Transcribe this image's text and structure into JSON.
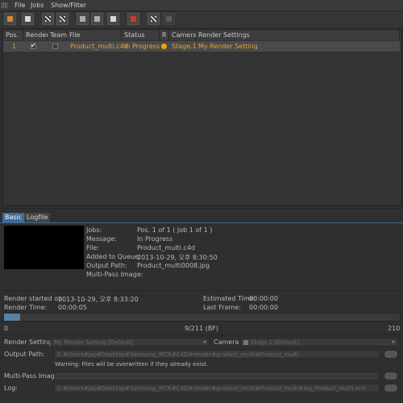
{
  "menu": [
    "File",
    "Jobs",
    "Show/Filter"
  ],
  "toolbar": {
    "icons": [
      "open-folder-icon",
      "new-document-icon",
      "clapboard-icon",
      "grid-clapboard-icon",
      "table-view-icon",
      "table-view-alt-icon",
      "document-list-icon",
      "render-stop-icon",
      "render-start-icon",
      "render-settings-disabled-icon"
    ]
  },
  "table": {
    "headers": [
      "Pos.",
      "Render",
      "Team",
      "File",
      "Status",
      "R",
      "Camera",
      "Render Settings"
    ],
    "rows": [
      {
        "pos": "1",
        "render": true,
        "team": false,
        "file": "Product_multi.c4d",
        "status": "In Progress",
        "camera": "Stage.1",
        "render_settings": "My Render Setting"
      }
    ]
  },
  "tabs": [
    "Basic",
    "Logfile"
  ],
  "details": {
    "jobs_label": "Jobs:",
    "jobs": "Pos. 1 of 1 ( Job 1 of 1 )",
    "message_label": "Message:",
    "message": "In Progress",
    "file_label": "File:",
    "file": "Product_multi.c4d",
    "added_label": "Added to Queue:",
    "added": "2013-10-29, 오후 8:30:50",
    "output_label": "Output Path:",
    "output": "Product_multi0008.jpg",
    "multipass_label": "Multi-Pass Image:"
  },
  "stats": {
    "started_label": "Render started on:",
    "started": "2013-10-29, 오후 8:33:20",
    "estimated_label": "Estimated Time:",
    "estimated": "00:00:00",
    "render_time_label": "Render Time:",
    "render_time": "00:00:05",
    "last_frame_label": "Last Frame:",
    "last_frame": "00:00:00"
  },
  "progress": {
    "start": "0",
    "status": "9/211 (BF)",
    "end": "210",
    "value": 0.04
  },
  "settings": {
    "render_settings_label": "Render Settings",
    "render_settings_value": "My Render Setting [Default]",
    "camera_label": "Camera",
    "camera_value": "Stage.1 [Default]",
    "output_path_label": "Output Path:",
    "output_path": "C:#Users#jap#Desktop#Samsung_IPCR#C4D#render#product_multi#Product_multi",
    "warning": "Warning: Files will be overwritten if they already exist.",
    "multipass_label": "Multi-Pass Image:",
    "multipass_path": "",
    "log_label": "Log:",
    "log_path": "C:#Users#jap#Desktop#Samsung_IPCR#C4D#render#product_multi#Product_multi#log_Product_multi.xml"
  }
}
